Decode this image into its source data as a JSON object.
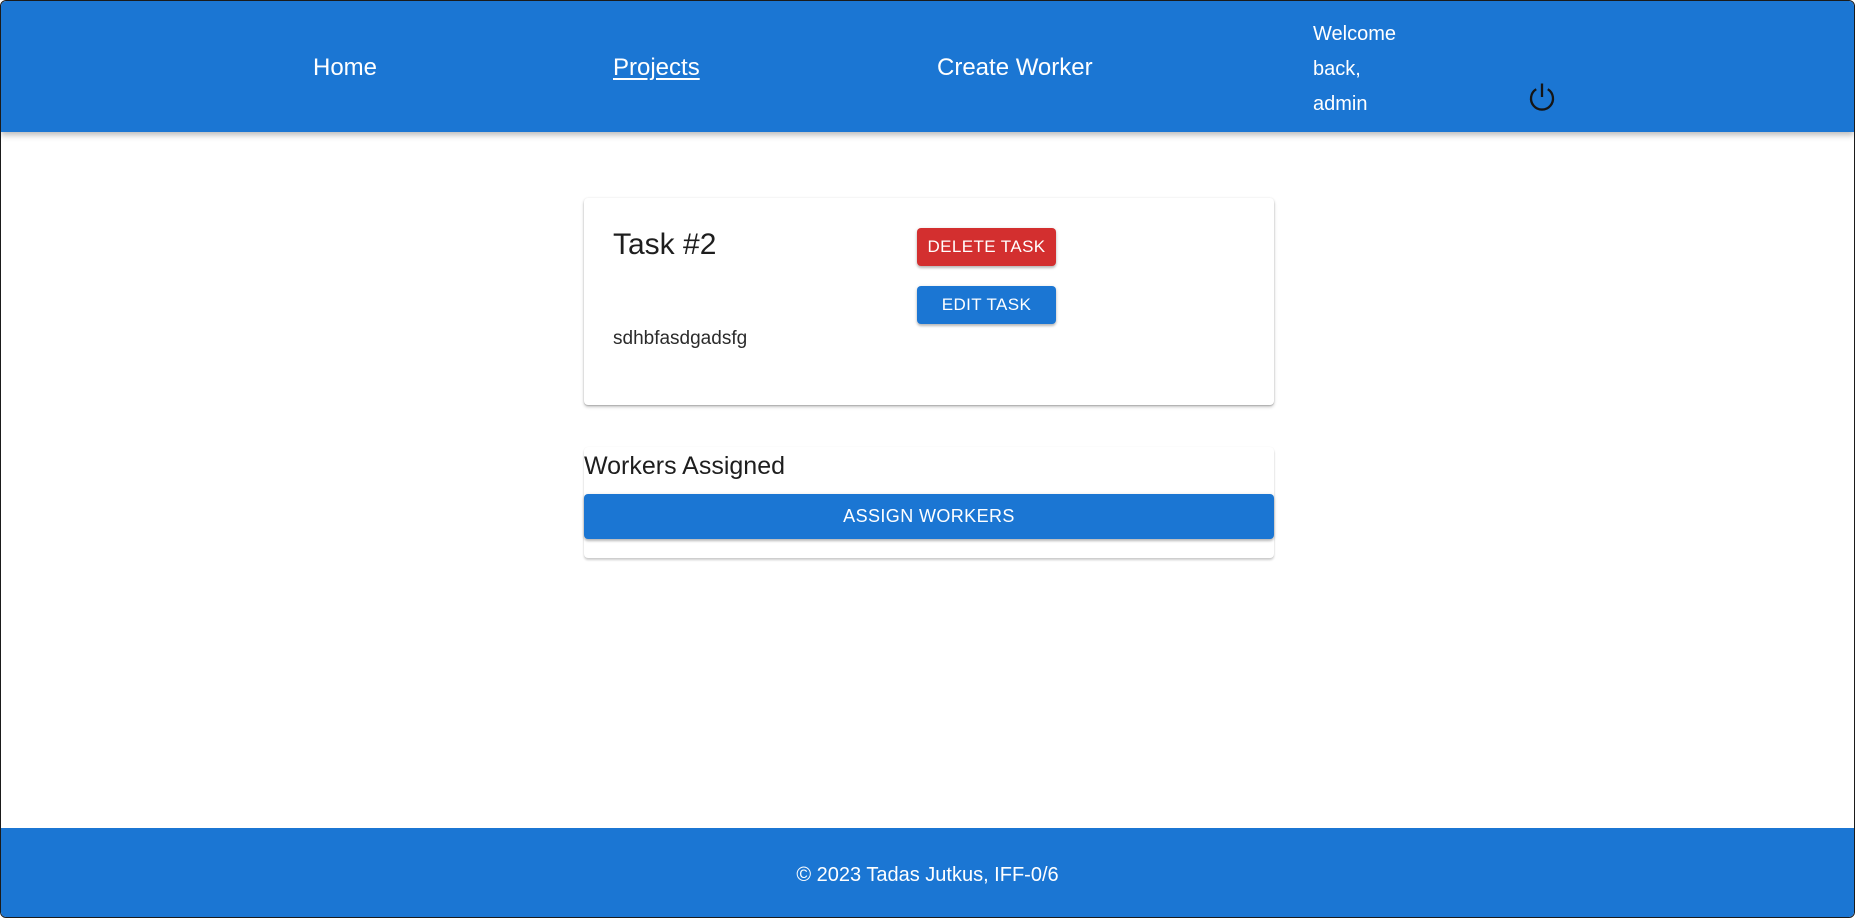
{
  "navbar": {
    "links": [
      {
        "label": "Home"
      },
      {
        "label": "Projects",
        "active": true
      },
      {
        "label": "Create Worker"
      }
    ],
    "welcome": "Welcome back, admin",
    "logout_icon": "power-icon"
  },
  "task": {
    "title": "Task #2",
    "description": "sdhbfasdgadsfg",
    "delete_label": "DELETE TASK",
    "edit_label": "EDIT TASK"
  },
  "workers": {
    "title": "Workers Assigned",
    "assign_label": "ASSIGN WORKERS"
  },
  "footer": {
    "text": "© 2023 Tadas Jutkus, IFF-0/6"
  },
  "colors": {
    "primary": "#1b76d3",
    "danger": "#d32f2f",
    "background": "#ffffff"
  }
}
